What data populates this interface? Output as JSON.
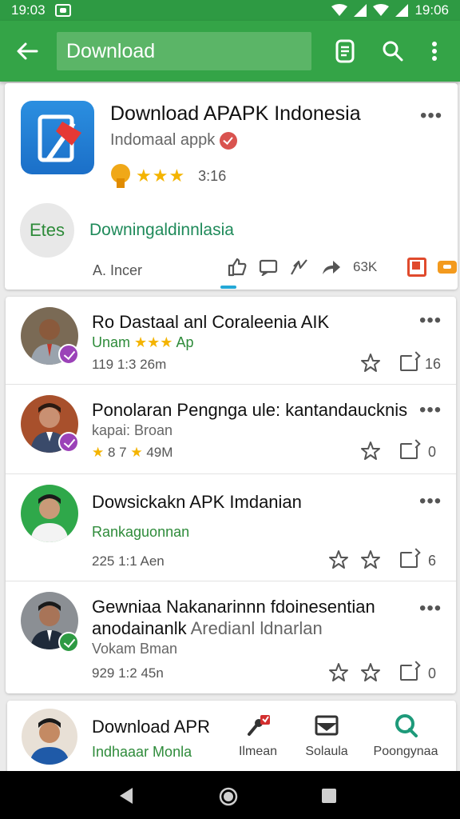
{
  "statusbar": {
    "time_left": "19:03",
    "time_right": "19:06"
  },
  "appbar": {
    "search_value": "Download"
  },
  "hero": {
    "title": "Download APAPK Indonesia",
    "subtitle": "Indomaal appk",
    "rating_count": "3:16",
    "logo_text": "Etes",
    "link_text": "Downingaldinnlasia",
    "author": "A. Incer",
    "share_count": "63K"
  },
  "posts": [
    {
      "title": "Ro Dastaal anl Coraleenia AIK",
      "sub_a": "Unam",
      "sub_b": "Ap",
      "meta": "119  1:3  26m",
      "count": "16"
    },
    {
      "title": "Ponolaran Pengnga ule: kantandaucknis",
      "sub": "kapai: Broan",
      "meta_a": "8  7",
      "meta_b": "49M",
      "count": "0"
    },
    {
      "title": "Dowsickakn APK Imdanian",
      "sub": "Rankaguonnan",
      "meta": "225  1:1  Aen",
      "count": "6"
    },
    {
      "title": "Gewniaa Nakanarinnn fdoinesentian",
      "title2_a": "anodainanlk",
      "title2_b": "Aredianl ldnarlan",
      "sub": "Vokam Bman",
      "meta": "929  1:2  45n",
      "count": "0"
    }
  ],
  "bottom": {
    "title": "Download APR",
    "sub": "Indhaaar Monla",
    "nav": [
      {
        "label": "Ilmean"
      },
      {
        "label": "Solaula"
      },
      {
        "label": "Poongynaa"
      }
    ]
  },
  "colors": {
    "appbar": "#34a447",
    "status": "#2e9a43",
    "star": "#f4b400",
    "link": "#1f8a5a"
  }
}
